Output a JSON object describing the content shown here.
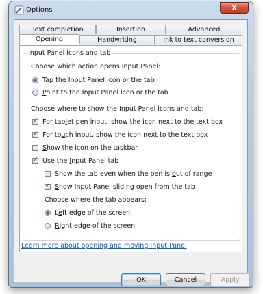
{
  "window": {
    "title": "Options",
    "close_glyph": "x"
  },
  "tabs_row1": [
    {
      "label": "Text completion"
    },
    {
      "label": "Insertion"
    },
    {
      "label": "Advanced"
    }
  ],
  "tabs_row2": [
    {
      "label": "Opening"
    },
    {
      "label": "Handwriting"
    },
    {
      "label": "Ink to text conversion"
    }
  ],
  "group": {
    "title": "Input Panel icons and tab"
  },
  "prompts": {
    "open_action": "Choose which action opens Input Panel:",
    "where_show": "Choose where to show the Input Panel icons and tab:",
    "tab_position": "Choose where the tab appears:"
  },
  "options": {
    "tap": {
      "pre": "",
      "key": "T",
      "post": "ap the Input Panel icon or the tab",
      "selected": true
    },
    "point": {
      "pre": "",
      "key": "P",
      "post": "oint to the Input Panel icon or the tab",
      "selected": false
    },
    "tablet_pen": {
      "pre": "For tab",
      "key": "l",
      "post": "et pen input, show the icon next to the text box",
      "checked": true
    },
    "touch": {
      "pre": "For to",
      "key": "u",
      "post": "ch input, show the icon next to the text box",
      "checked": true
    },
    "taskbar": {
      "pre": "",
      "key": "S",
      "post": "how the icon on the taskbar",
      "checked": false
    },
    "use_tab": {
      "pre": "Use the ",
      "key": "I",
      "post": "nput Panel tab",
      "checked": true
    },
    "show_tab_out": {
      "pre": "Show the tab even when the pen is ",
      "key": "o",
      "post": "ut of range",
      "checked": false
    },
    "sliding": {
      "pre": "",
      "key": "S",
      "post": "how Input Panel sliding open from the tab",
      "checked": true
    },
    "left_edge": {
      "pre": "L",
      "key": "e",
      "post": "ft edge of the screen",
      "selected": true
    },
    "right_edge": {
      "pre": "",
      "key": "R",
      "post": "ight edge of the screen",
      "selected": false
    }
  },
  "link": "Learn more about opening and moving Input Panel",
  "buttons": {
    "ok": "OK",
    "cancel": "Cancel",
    "apply": "Apply"
  }
}
